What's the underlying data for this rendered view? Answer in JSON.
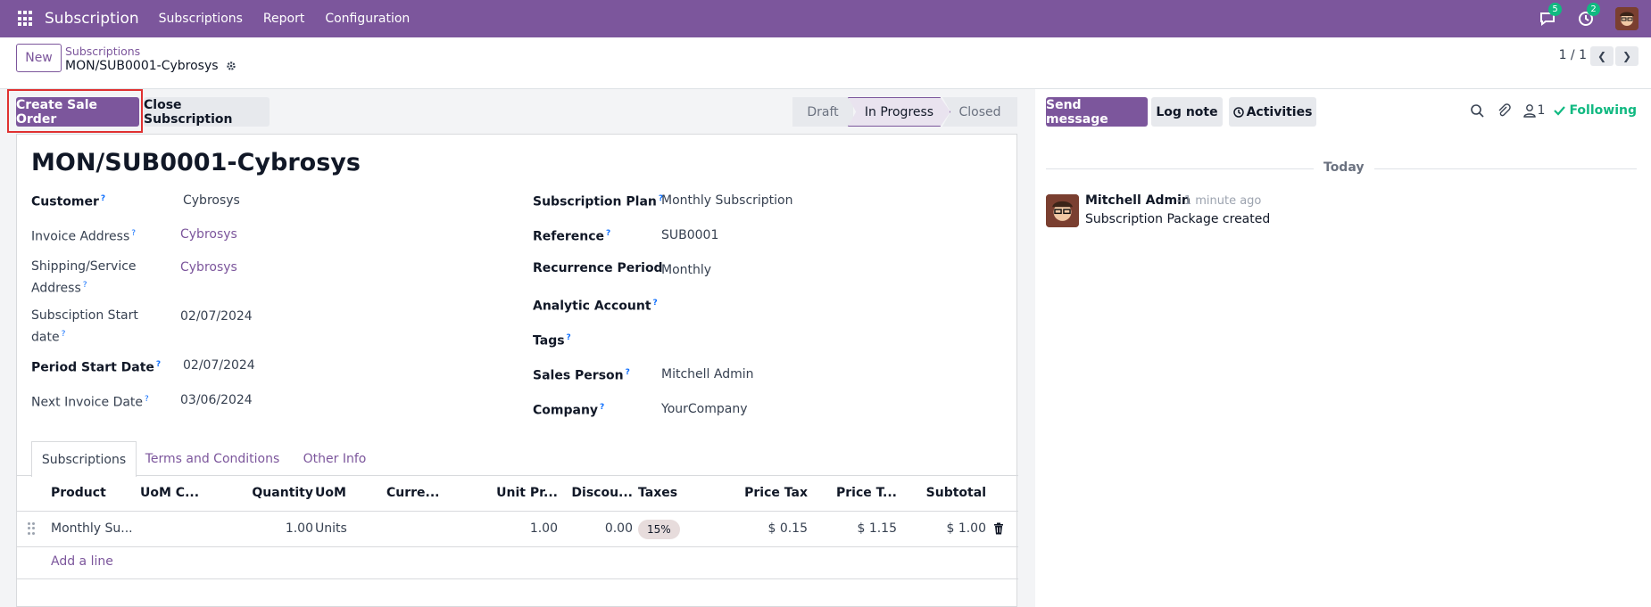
{
  "navbar": {
    "app_name": "Subscription",
    "menu": [
      "Subscriptions",
      "Report",
      "Configuration"
    ],
    "messages_badge": "5",
    "activities_badge": "2",
    "icons": [
      "apps-grid-icon",
      "chat-icon",
      "clock-icon",
      "user-avatar"
    ]
  },
  "control_panel": {
    "new_label": "New",
    "breadcrumb_parent": "Subscriptions",
    "breadcrumb_current": "MON/SUB0001-Cybrosys",
    "pager": "1 / 1",
    "prev_icon": "chevron-left-icon",
    "next_icon": "chevron-right-icon"
  },
  "status_bar": {
    "create_sale_order": "Create Sale Order",
    "close_subscription": "Close Subscription",
    "stages": [
      "Draft",
      "In Progress",
      "Closed"
    ],
    "current_stage": "In Progress"
  },
  "form": {
    "title": "MON/SUB0001-Cybrosys",
    "left_fields": [
      {
        "label": "Customer",
        "value": "Cybrosys"
      },
      {
        "label": "Invoice Address",
        "value": "Cybrosys"
      },
      {
        "label": "Shipping/Service",
        "label2": "Address",
        "value": "Cybrosys"
      },
      {
        "label": "Subsciption Start",
        "label2": "date",
        "value": "02/07/2024"
      },
      {
        "label": "Period Start Date",
        "value": "02/07/2024"
      },
      {
        "label": "Next Invoice Date",
        "value": "03/06/2024"
      }
    ],
    "right_fields": [
      {
        "label": "Subscription Plan",
        "value": "Monthly Subscription"
      },
      {
        "label": "Reference",
        "value": "SUB0001"
      },
      {
        "label": "Recurrence Period",
        "value": "Monthly"
      },
      {
        "label": "Analytic Account",
        "value": ""
      },
      {
        "label": "Tags",
        "value": ""
      },
      {
        "label": "Sales Person",
        "value": "Mitchell Admin"
      },
      {
        "label": "Company",
        "value": "YourCompany"
      }
    ],
    "help_mark": "?"
  },
  "notebook": {
    "tabs": [
      "Subscriptions",
      "Terms and Conditions",
      "Other Info"
    ],
    "active_tab": "Subscriptions",
    "columns": [
      "Product",
      "UoM C...",
      "Quantity",
      "UoM",
      "Curre...",
      "Unit Pr...",
      "Discou...",
      "Taxes",
      "Price Tax",
      "Price T...",
      "Subtotal"
    ],
    "rows": [
      {
        "product": "Monthly Su...",
        "uom_c": "",
        "quantity": "1.00",
        "uom": "Units",
        "currency": "",
        "unit_price": "1.00",
        "discount": "0.00",
        "taxes": "15%",
        "price_tax": "$ 0.15",
        "price_total": "$ 1.15",
        "subtotal": "$ 1.00"
      }
    ],
    "add_line": "Add a line"
  },
  "chatter": {
    "send_message": "Send message",
    "log_note": "Log note",
    "activities": "Activities",
    "followers_count": "1",
    "following": "Following",
    "date_separator": "Today",
    "messages": [
      {
        "author": "Mitchell Admin",
        "time": "- 1 minute ago",
        "body": "Subscription Package created"
      }
    ]
  },
  "colors": {
    "brand": "#7c569c",
    "following_green": "#10b981",
    "highlight_red": "#e03131"
  }
}
